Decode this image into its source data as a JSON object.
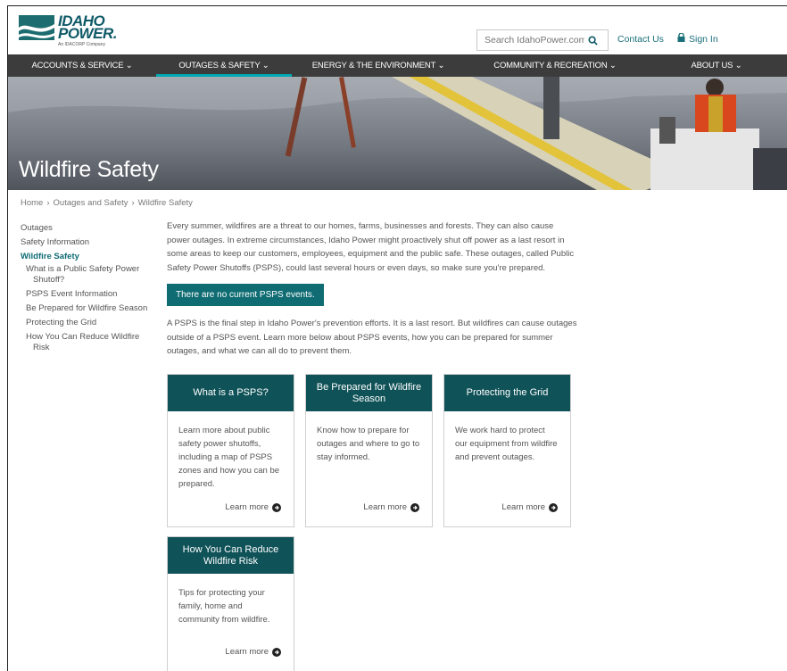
{
  "header": {
    "logo_line1": "IDAHO",
    "logo_line2": "POWER.",
    "logo_sub": "An IDACORP Company",
    "search_placeholder": "Search IdahoPower.com",
    "contact_label": "Contact Us",
    "signin_label": "Sign In"
  },
  "nav": {
    "items": [
      {
        "label": "ACCOUNTS & SERVICE ⌄"
      },
      {
        "label": "OUTAGES & SAFETY ⌄"
      },
      {
        "label": "ENERGY & THE ENVIRONMENT ⌄"
      },
      {
        "label": "COMMUNITY & RECREATION ⌄"
      },
      {
        "label": "ABOUT US ⌄"
      }
    ]
  },
  "hero": {
    "title": "Wildfire Safety"
  },
  "breadcrumb": {
    "items": [
      "Home",
      "Outages and Safety",
      "Wildfire Safety"
    ],
    "separator": "›"
  },
  "sidebar": {
    "items": [
      {
        "label": "Outages"
      },
      {
        "label": "Safety Information"
      },
      {
        "label": "Wildfire Safety"
      }
    ],
    "subitems": [
      {
        "label1": "What is a Public Safety Power",
        "label2": "Shutoff?"
      },
      {
        "label1": "PSPS Event Information",
        "label2": ""
      },
      {
        "label1": "Be Prepared for Wildfire Season",
        "label2": ""
      },
      {
        "label1": "Protecting the Grid",
        "label2": ""
      },
      {
        "label1": "How You Can Reduce Wildfire",
        "label2": "Risk"
      }
    ]
  },
  "main": {
    "intro": "Every summer, wildfires are a threat to our homes, farms, businesses and forests. They can also cause power outages. In extreme circumstances, Idaho Power might proactively shut off power as a last resort in some areas to keep our customers, employees, equipment and the public safe. These outages, called Public Safety Power Shutoffs (PSPS), could last several hours or even days, so make sure you're prepared.",
    "status": "There are no current PSPS events.",
    "followup": "A PSPS is the final step in Idaho Power's prevention efforts. It is a last resort. But wildfires can cause outages outside of a PSPS event. Learn more below about PSPS events, how you can be prepared for summer outages, and what we can all do to prevent them."
  },
  "cards": [
    {
      "title": "What is a PSPS?",
      "body": "Learn more about public safety power shutoffs, including a map of PSPS zones and how you can be prepared.",
      "more": "Learn more"
    },
    {
      "title": "Be Prepared for Wildfire Season",
      "body": "Know how to prepare for outages and where to go to stay informed.",
      "more": "Learn more"
    },
    {
      "title": "Protecting the Grid",
      "body": "We work hard to protect our equipment from wildfire and prevent outages.",
      "more": "Learn more"
    },
    {
      "title": "How You Can Reduce Wildfire Risk",
      "body": "Tips for protecting your family, home and community from wildfire.",
      "more": "Learn more"
    }
  ],
  "colors": {
    "brand_teal": "#0f5258",
    "accent_teal": "#0f6c73",
    "nav_bg": "#3c3c3c",
    "nav_active": "#00a8b3",
    "link": "#1a6f7a"
  }
}
